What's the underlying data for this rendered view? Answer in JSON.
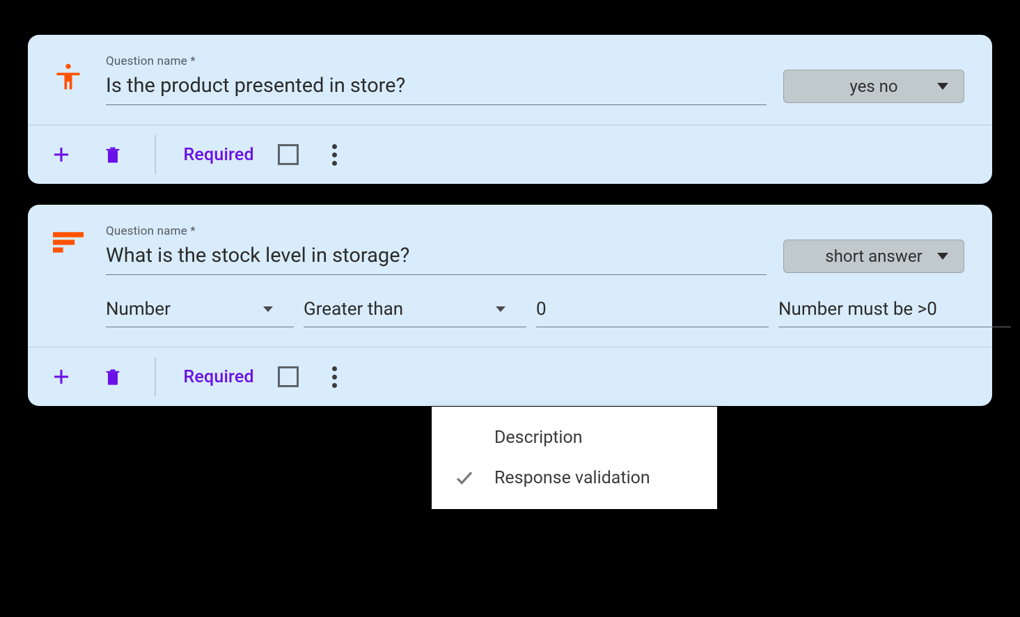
{
  "questions": [
    {
      "label": "Question name *",
      "name": "Is the product presented in store?",
      "type_label": "yes no",
      "required_label": "Required",
      "required_checked": false,
      "icon": "person"
    },
    {
      "label": "Question name *",
      "name": "What is the stock level in storage?",
      "type_label": "short answer",
      "required_label": "Required",
      "required_checked": false,
      "icon": "short-text",
      "validation": {
        "type": "Number",
        "condition": "Greater than",
        "value": "0",
        "error_message": "Number must be >0"
      }
    }
  ],
  "popup": {
    "items": [
      {
        "label": "Description",
        "checked": false
      },
      {
        "label": "Response validation",
        "checked": true
      }
    ]
  }
}
